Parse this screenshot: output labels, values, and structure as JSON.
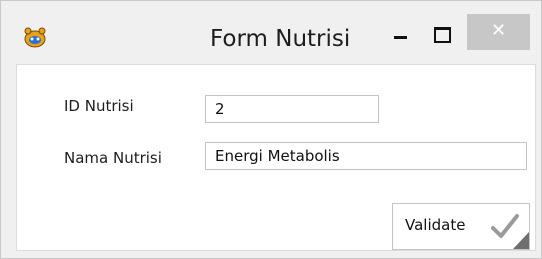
{
  "window": {
    "title": "Form Nutrisi",
    "close_symbol": "✕",
    "app_icon": "app-logo-icon"
  },
  "form": {
    "id_label": "ID Nutrisi",
    "id_value": "2",
    "nama_label": "Nama Nutrisi",
    "nama_value": "Energi Metabolis"
  },
  "actions": {
    "validate_label": "Validate",
    "validate_icon": "checkmark-icon"
  },
  "colors": {
    "close_button_bg": "#c7c7c7",
    "check_color": "#9a9a9a"
  }
}
